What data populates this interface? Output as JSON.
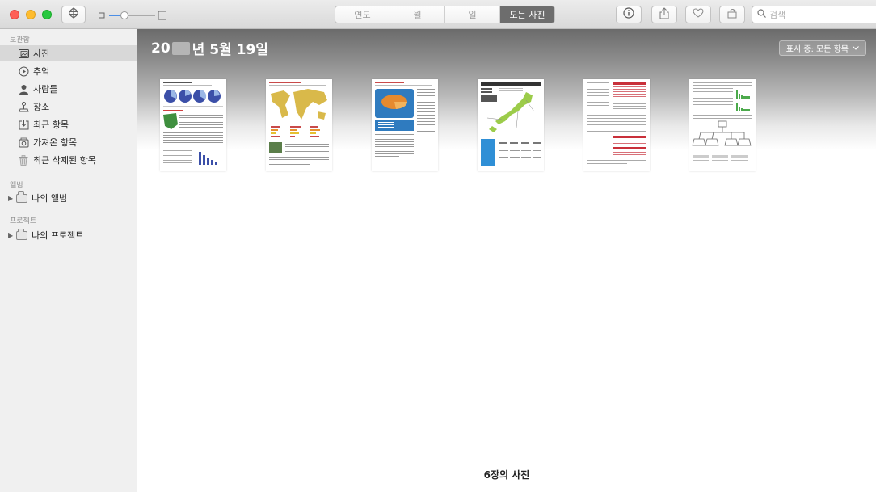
{
  "toolbar": {
    "segments": [
      {
        "label": "연도",
        "active": false
      },
      {
        "label": "월",
        "active": false
      },
      {
        "label": "일",
        "active": false
      },
      {
        "label": "모든 사진",
        "active": true
      }
    ],
    "search_placeholder": "검색",
    "icons": [
      "sidebar-toggle-icon",
      "info-icon",
      "share-icon",
      "heart-icon",
      "rotate-icon",
      "search-icon"
    ]
  },
  "sidebar": {
    "library_header": "보관함",
    "library_items": [
      {
        "label": "사진",
        "icon": "photos-icon",
        "selected": true
      },
      {
        "label": "추억",
        "icon": "memories-icon",
        "selected": false
      },
      {
        "label": "사람들",
        "icon": "people-icon",
        "selected": false
      },
      {
        "label": "장소",
        "icon": "places-icon",
        "selected": false
      },
      {
        "label": "최근 항목",
        "icon": "recent-icon",
        "selected": false
      },
      {
        "label": "가져온 항목",
        "icon": "imports-icon",
        "selected": false
      },
      {
        "label": "최근 삭제된 항목",
        "icon": "trash-icon",
        "selected": false
      }
    ],
    "albums_header": "앨범",
    "albums_item": "나의 앨범",
    "projects_header": "프로젝트",
    "projects_item": "나의 프로젝트"
  },
  "main": {
    "date_prefix": "20",
    "date_suffix": "년 5월 19일",
    "show_button": "표시 중: 모든 항목",
    "footer": "6장의 사진"
  },
  "colors": {
    "selected_segment": "#6d6d6d",
    "traffic_red": "#fe5f57",
    "traffic_yellow": "#febc2e",
    "traffic_green": "#28c840"
  }
}
